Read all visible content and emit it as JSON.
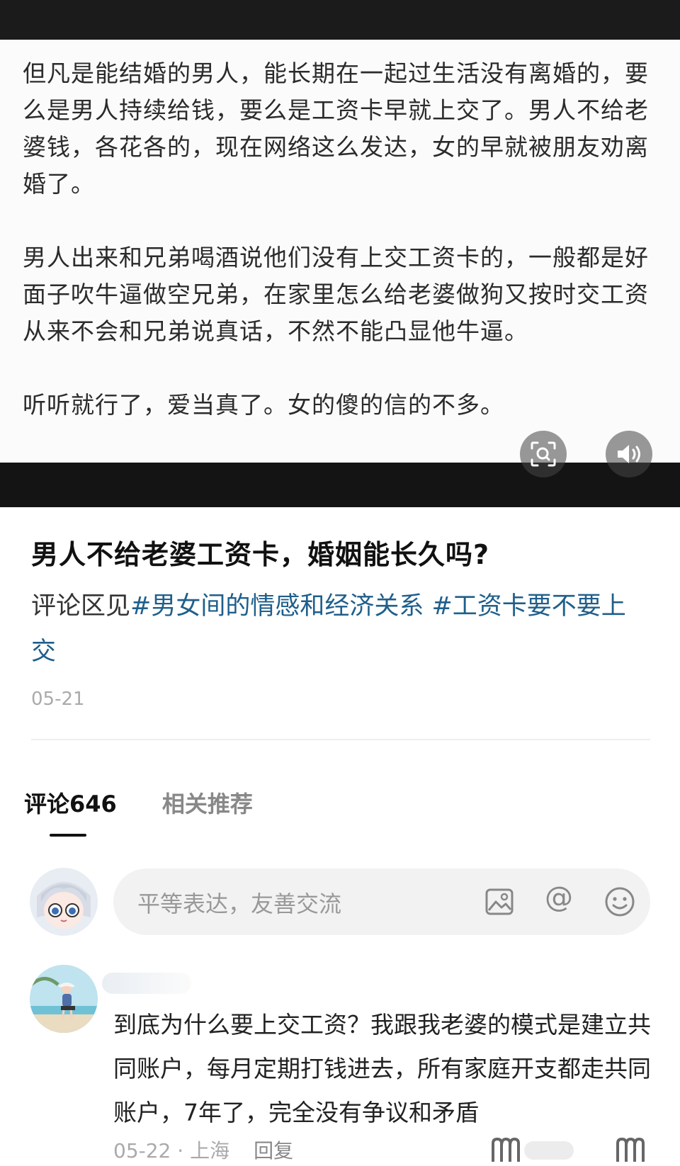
{
  "image_post": {
    "paragraphs": [
      "但凡是能结婚的男人，能长期在一起过生活没有离婚的，要么是男人持续给钱，要么是工资卡早就上交了。男人不给老婆钱，各花各的，现在网络这么发达，女的早就被朋友劝离婚了。",
      "男人出来和兄弟喝酒说他们没有上交工资卡的，一般都是好面子吹牛逼做空兄弟，在家里怎么给老婆做狗又按时交工资从来不会和兄弟说真话，不然不能凸显他牛逼。",
      "听听就行了，爱当真了。女的傻的信的不多。"
    ],
    "lens_icon": "image-search-icon",
    "sound_icon": "speaker-icon"
  },
  "post": {
    "title": "男人不给老婆工资卡，婚姻能长久吗?",
    "desc_prefix": "评论区见",
    "hashtags": [
      "#男女间的情感和经济关系",
      "#工资卡要不要上交"
    ],
    "date": "05-21"
  },
  "tabs": {
    "comments": "评论646",
    "related": "相关推荐"
  },
  "comment_input": {
    "placeholder": "平等表达，友善交流",
    "icons": [
      "image-icon",
      "at-icon",
      "emoji-icon"
    ],
    "at_glyph": "@"
  },
  "comment": {
    "text": "到底为什么要上交工资？我跟我老婆的模式是建立共同账户，每月定期打钱进去，所有家庭开支都走共同账户，7年了，完全没有争议和矛盾",
    "date_location": "05-22 · 上海",
    "reply_label": "回复"
  },
  "colors": {
    "hashtag": "#1f5f8b",
    "muted": "#aaaaaa",
    "input_bg": "#f2f2f2"
  }
}
